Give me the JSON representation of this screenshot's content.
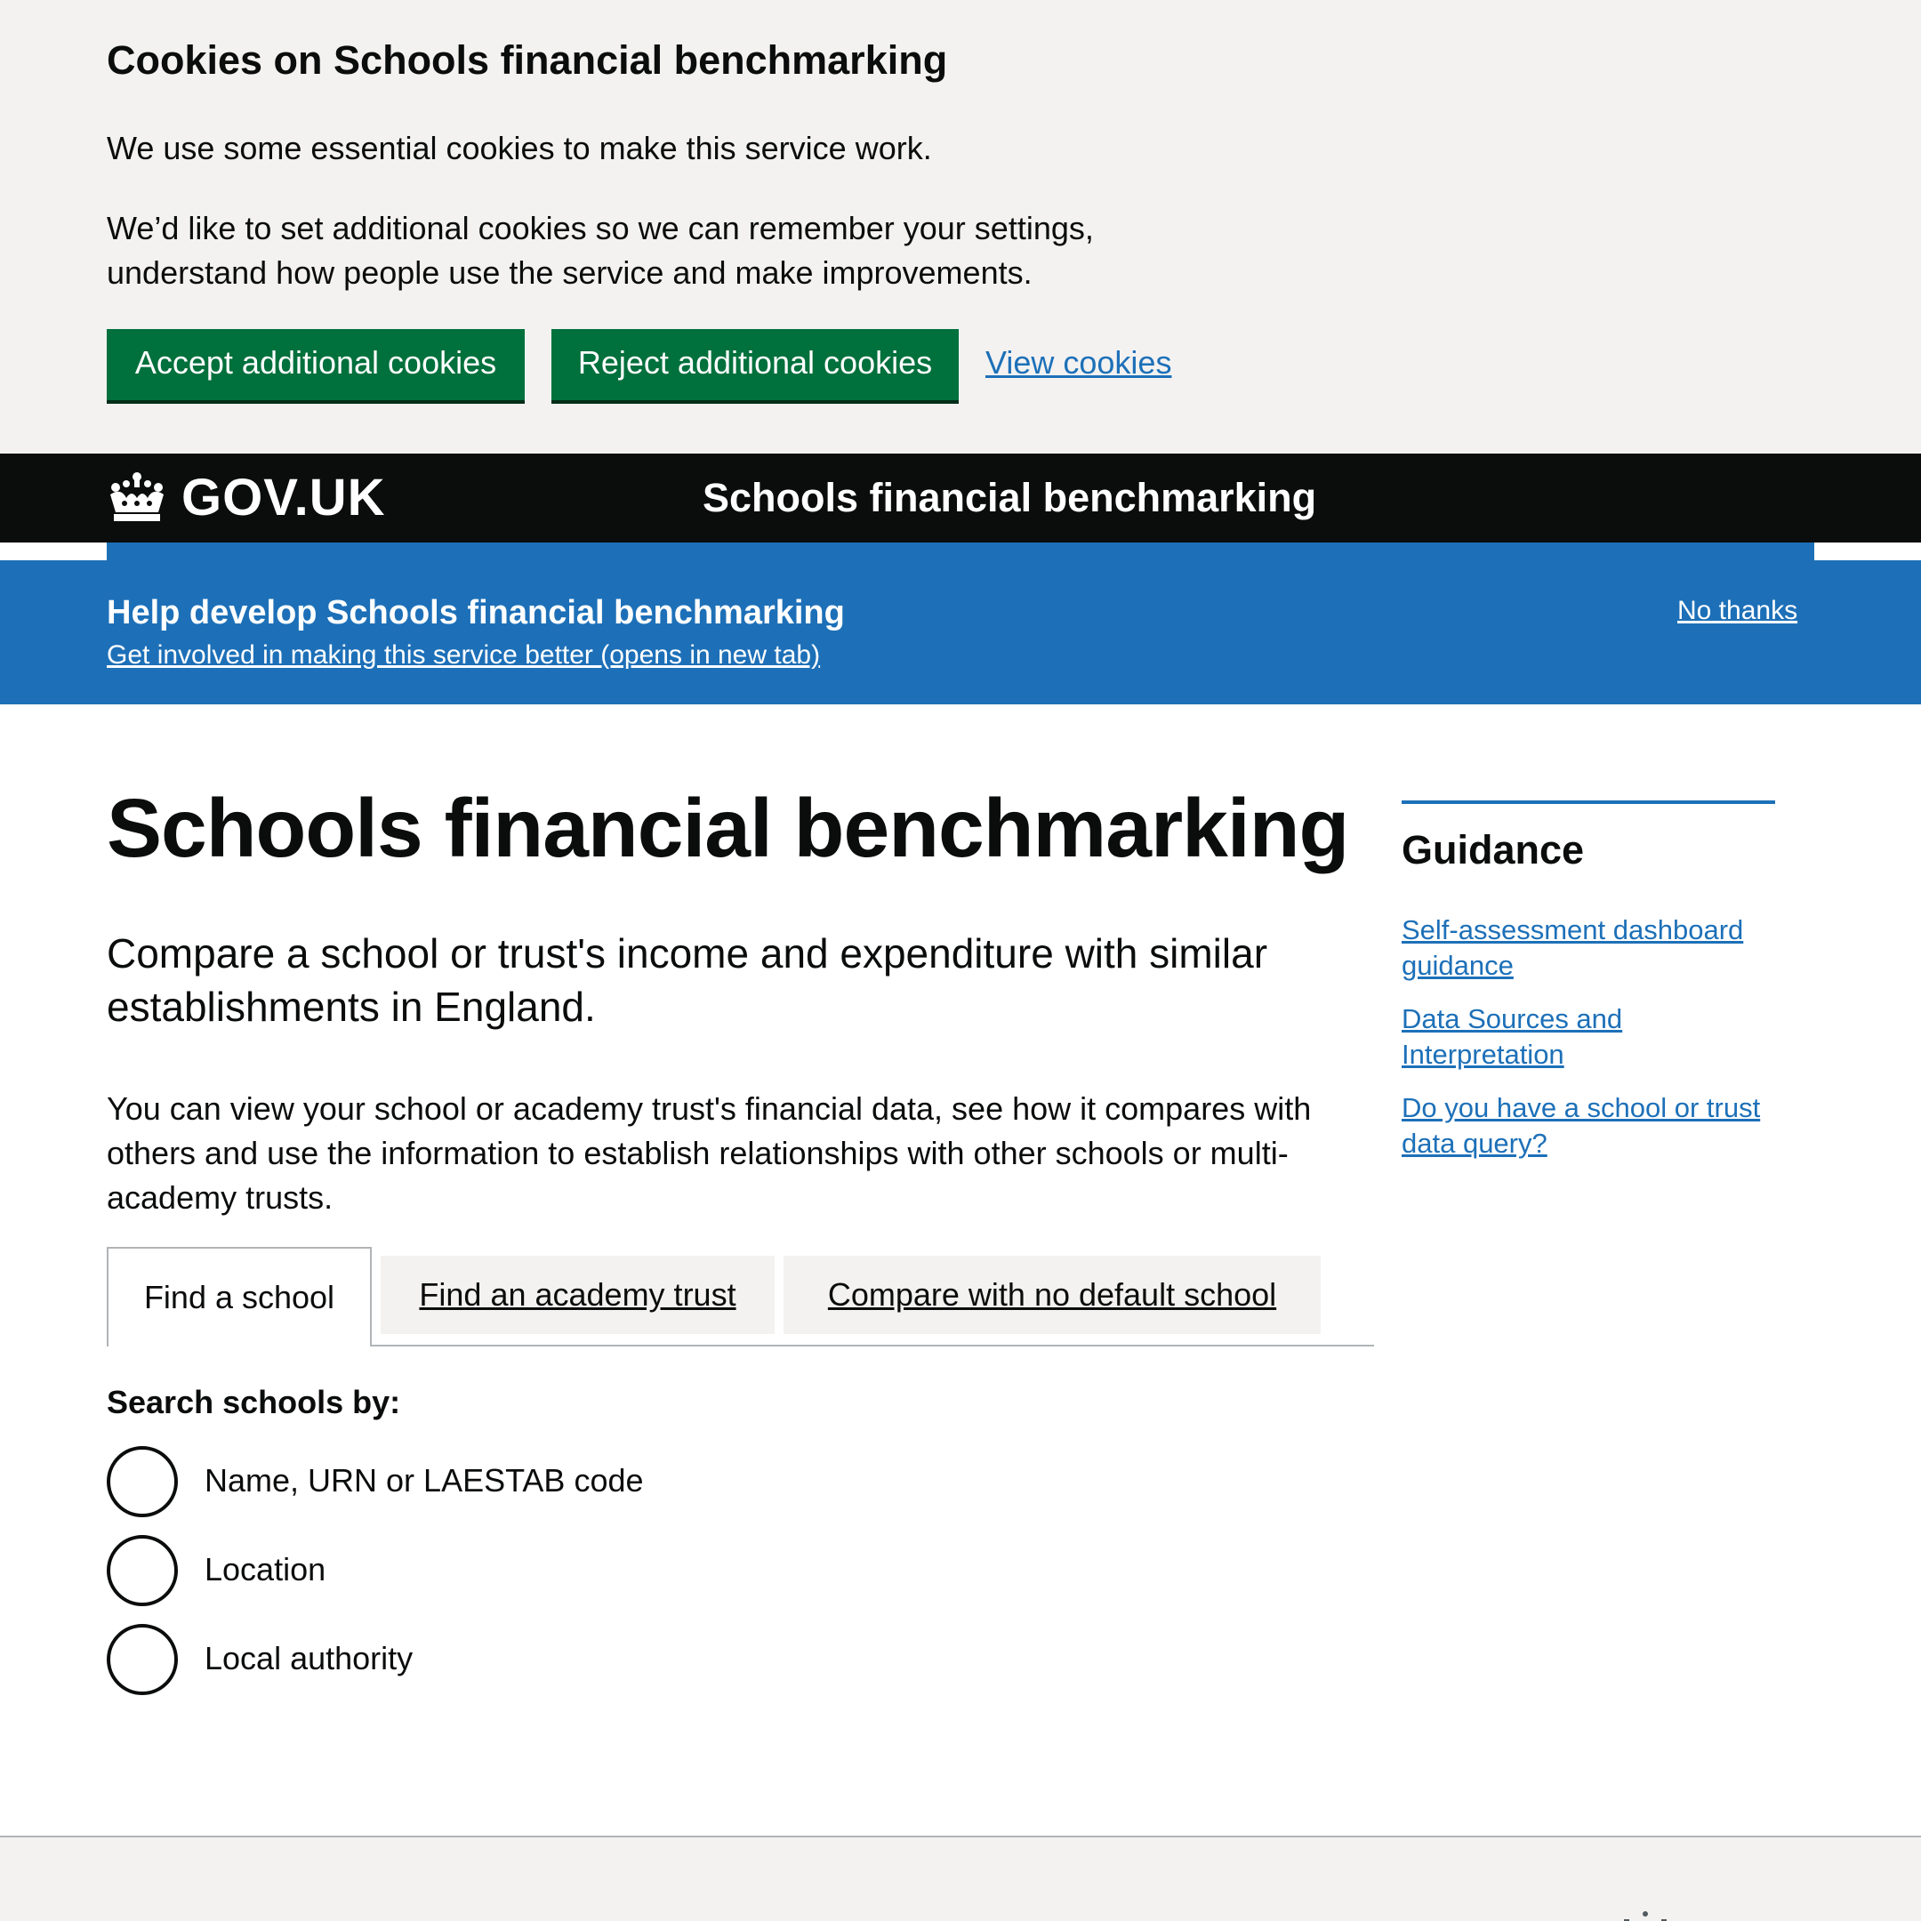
{
  "cookie_banner": {
    "heading": "Cookies on Schools financial benchmarking",
    "paragraph_1": "We use some essential cookies to make this service work.",
    "paragraph_2": "We’d like to set additional cookies so we can remember your settings, understand how people use the service and make improvements.",
    "accept_label": "Accept additional cookies",
    "reject_label": "Reject additional cookies",
    "view_label": "View cookies"
  },
  "header": {
    "logo_text": "GOV.UK",
    "logo_icon": "crown-icon",
    "service_name": "Schools financial benchmarking"
  },
  "research_banner": {
    "title": "Help develop Schools financial benchmarking",
    "link": "Get involved in making this service better (opens in new tab)",
    "dismiss": "No thanks"
  },
  "main": {
    "title": "Schools financial benchmarking",
    "lead": "Compare a school or trust's income and expenditure with similar establishments in England.",
    "body": "You can view your school or academy trust's financial data, see how it compares with others and use the information to establish relationships with other schools or multi-academy trusts.",
    "tabs": [
      {
        "label": "Find a school",
        "active": true
      },
      {
        "label": "Find an academy trust",
        "active": false
      },
      {
        "label": "Compare with no default school",
        "active": false
      }
    ],
    "search_label": "Search schools by:",
    "radio_options": [
      {
        "label": "Name, URN or LAESTAB code"
      },
      {
        "label": "Location"
      },
      {
        "label": "Local authority"
      }
    ]
  },
  "sidebar": {
    "heading": "Guidance",
    "links": [
      {
        "label": "Self-assessment dashboard guidance"
      },
      {
        "label": "Data Sources and Interpretation"
      },
      {
        "label": "Do you have a school or trust data query?"
      }
    ]
  },
  "colors": {
    "button_green": "#00703c",
    "link_blue": "#1d70b8",
    "header_black": "#0b0c0c",
    "banner_grey": "#f3f2f1"
  }
}
